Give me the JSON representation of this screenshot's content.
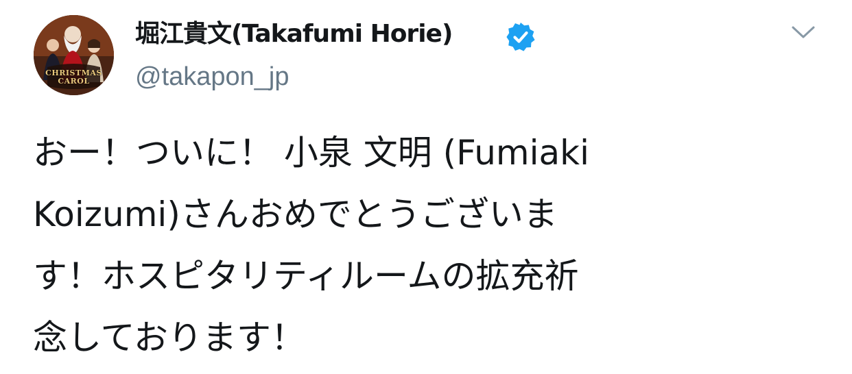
{
  "tweet": {
    "author": {
      "display_name": "堀江貴文(Takafumi Horie)",
      "handle": "@takapon_jp",
      "verified": true,
      "avatar_caption": [
        "CHRISTMAS",
        "CAROL"
      ]
    },
    "text_lines": [
      "おー！ついに！ 小泉 文明 (Fumiaki",
      "Koizumi)さんおめでとうございま",
      "す！ホスピタリティルームの拡充祈",
      "念しております！"
    ],
    "menu_icon": "chevron-down-icon",
    "colors": {
      "verified_blue": "#1da1f2",
      "handle_gray": "#657786",
      "text": "#14171a",
      "chevron": "#8899a6"
    }
  }
}
